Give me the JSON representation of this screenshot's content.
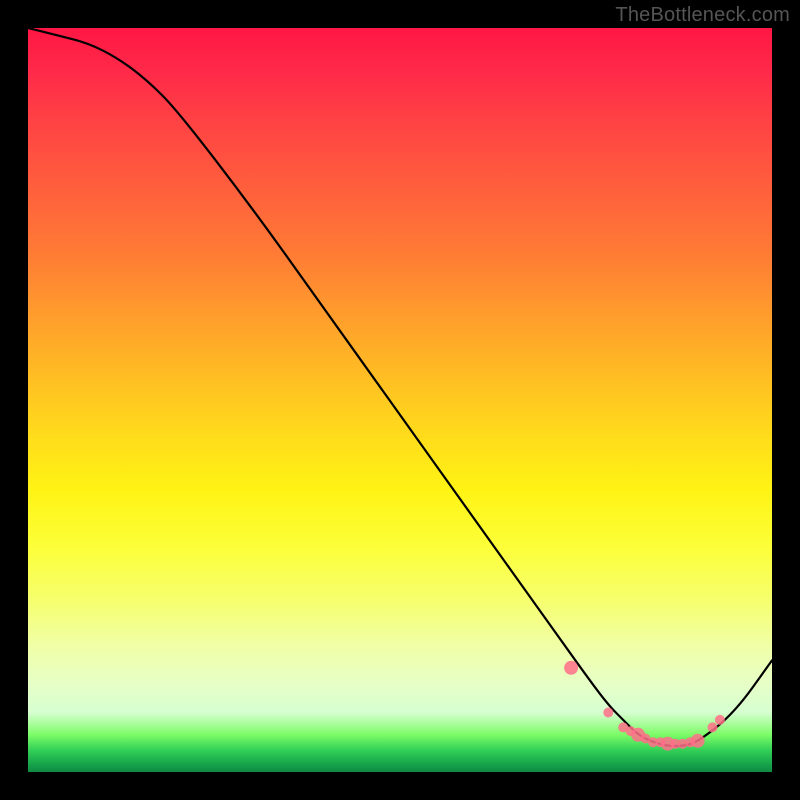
{
  "watermark": "TheBottleneck.com",
  "chart_data": {
    "type": "line",
    "title": "",
    "xlabel": "",
    "ylabel": "",
    "xlim": [
      0,
      100
    ],
    "ylim": [
      0,
      100
    ],
    "series": [
      {
        "name": "curve",
        "x": [
          0,
          4,
          8,
          12,
          16,
          20,
          30,
          40,
          50,
          60,
          70,
          75,
          78,
          80,
          82,
          84,
          86,
          88,
          90,
          95,
          100
        ],
        "y": [
          100,
          99,
          98,
          96,
          93,
          89,
          76,
          62,
          48,
          34,
          20,
          13,
          9,
          7,
          5,
          4,
          3.5,
          3.5,
          4,
          8,
          15
        ]
      }
    ],
    "marker_cluster": {
      "name": "pink-markers",
      "color": "#ff6e8a",
      "points_x": [
        73,
        78,
        80,
        81,
        82,
        83,
        84,
        85,
        86,
        87,
        88,
        89,
        90,
        92,
        93
      ],
      "points_y": [
        14,
        8,
        6,
        5.5,
        5,
        4.5,
        4,
        4,
        3.8,
        3.8,
        3.8,
        4,
        4.2,
        6,
        7
      ]
    },
    "gradient_stops": [
      {
        "pos": 0,
        "color": "#ff1744"
      },
      {
        "pos": 50,
        "color": "#ffd000"
      },
      {
        "pos": 80,
        "color": "#f6ff6e"
      },
      {
        "pos": 100,
        "color": "#0f8a42"
      }
    ]
  }
}
